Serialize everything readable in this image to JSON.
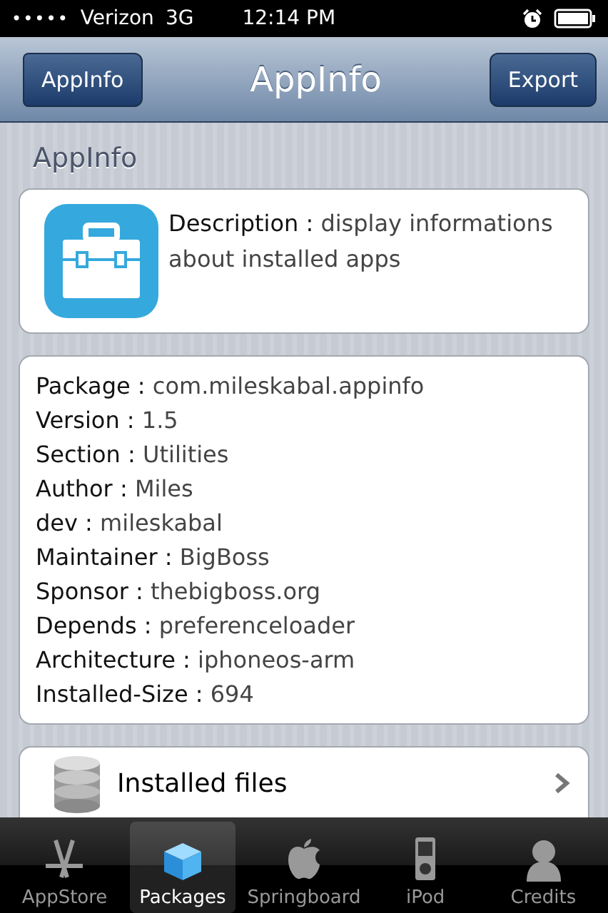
{
  "status_bar": {
    "signal_dots": "•••••",
    "carrier": "Verizon",
    "network": "3G",
    "time": "12:14 PM"
  },
  "nav_bar": {
    "back_button": "AppInfo",
    "title": "AppInfo",
    "action_button": "Export"
  },
  "section_title": "AppInfo",
  "description": {
    "label": "Description :",
    "value": "display informations about installed apps"
  },
  "details": [
    {
      "label": "Package :",
      "value": "com.mileskabal.appinfo"
    },
    {
      "label": "Version :",
      "value": "1.5"
    },
    {
      "label": "Section :",
      "value": "Utilities"
    },
    {
      "label": "Author :",
      "value": "Miles"
    },
    {
      "label": "dev :",
      "value": "mileskabal"
    },
    {
      "label": "Maintainer :",
      "value": "BigBoss"
    },
    {
      "label": "Sponsor :",
      "value": "thebigboss.org"
    },
    {
      "label": "Depends :",
      "value": "preferenceloader"
    },
    {
      "label": "Architecture :",
      "value": "iphoneos-arm"
    },
    {
      "label": "Installed-Size :",
      "value": "694"
    }
  ],
  "links": [
    {
      "label": "Installed files"
    }
  ],
  "tab_bar": [
    {
      "kind": "appstore",
      "label": "AppStore",
      "selected": false
    },
    {
      "kind": "packages",
      "label": "Packages",
      "selected": true
    },
    {
      "kind": "springboard",
      "label": "Springboard",
      "selected": false
    },
    {
      "kind": "ipod",
      "label": "iPod",
      "selected": false
    },
    {
      "kind": "credits",
      "label": "Credits",
      "selected": false
    }
  ]
}
